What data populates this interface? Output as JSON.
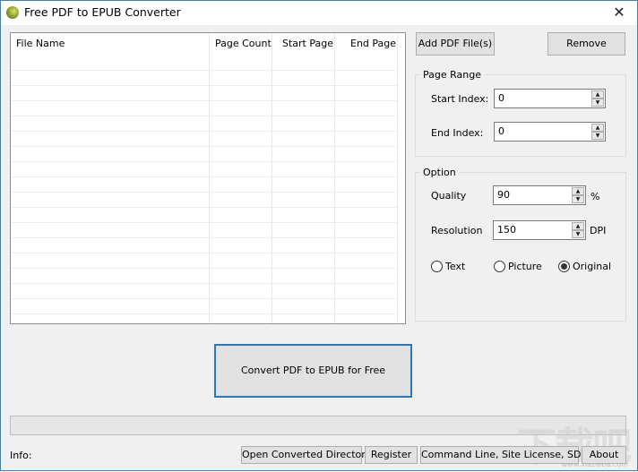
{
  "window": {
    "title": "Free PDF to EPUB Converter",
    "close_icon": "✕"
  },
  "file_list": {
    "columns": [
      "File Name",
      "Page Count",
      "Start Page",
      "End Page"
    ],
    "rows": []
  },
  "buttons": {
    "add": "Add PDF File(s)",
    "remove": "Remove",
    "convert": "Convert PDF to EPUB for Free",
    "open_dir": "Open Converted Directory",
    "register": "Register",
    "command_line": "Command Line, Site License, SDK",
    "about": "About"
  },
  "page_range": {
    "label": "Page Range",
    "start_label": "Start Index:",
    "start_value": "0",
    "end_label": "End Index:",
    "end_value": "0"
  },
  "option": {
    "label": "Option",
    "quality_label": "Quality",
    "quality_value": "90",
    "quality_unit": "%",
    "resolution_label": "Resolution",
    "resolution_value": "150",
    "resolution_unit": "DPI",
    "modes": [
      "Text",
      "Picture",
      "Original"
    ],
    "selected_mode": "Original"
  },
  "status": {
    "info_label": "Info:",
    "progress": 0
  },
  "watermark": {
    "text": "下载吧",
    "url": "www.xiazaiba.com"
  },
  "icons": {
    "spin_up": "▲",
    "spin_down": "▼"
  }
}
